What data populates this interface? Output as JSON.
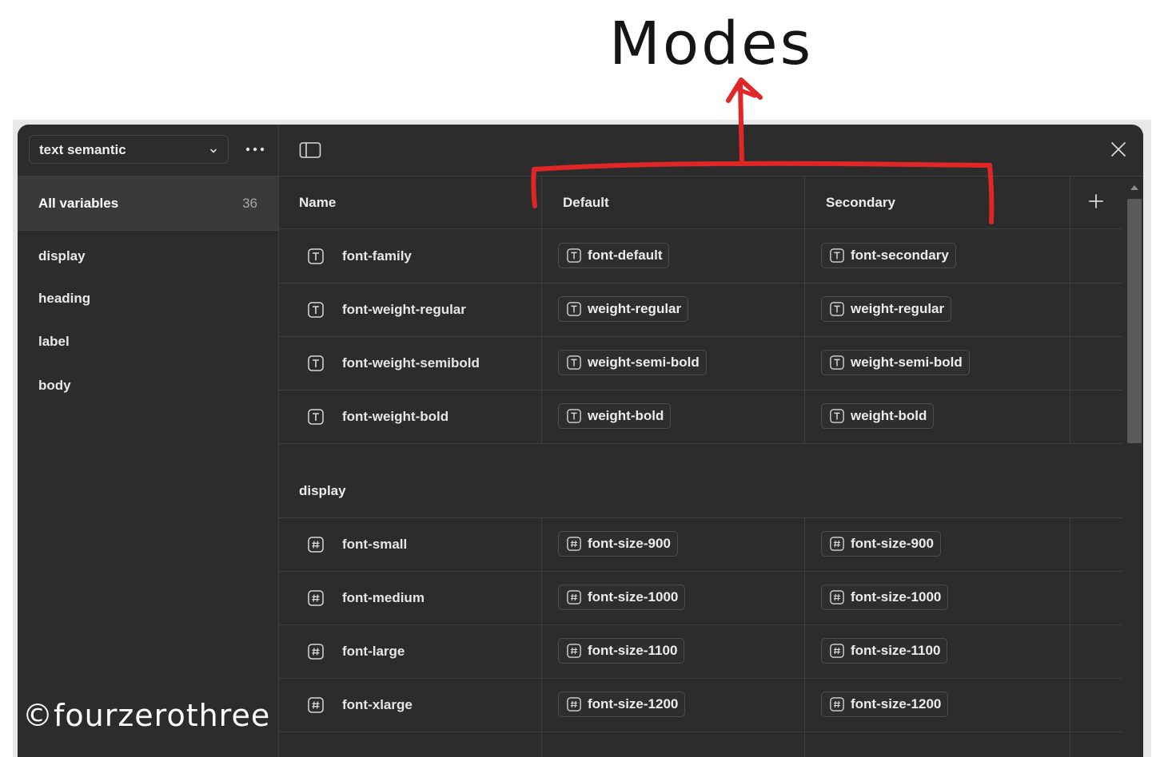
{
  "annotation": {
    "title": "Modes",
    "watermark": "©fourzerothree",
    "arrow_color": "#e02626"
  },
  "sidebar": {
    "collection": "text semantic",
    "all_variables_label": "All variables",
    "all_variables_count": "36",
    "groups": [
      {
        "label": "display"
      },
      {
        "label": "heading"
      },
      {
        "label": "label"
      },
      {
        "label": "body"
      }
    ]
  },
  "table": {
    "columns": {
      "name": "Name",
      "mode1": "Default",
      "mode2": "Secondary"
    },
    "rows": [
      {
        "type": "string",
        "name": "font-family",
        "default": "font-default",
        "secondary": "font-secondary"
      },
      {
        "type": "string",
        "name": "font-weight-regular",
        "default": "weight-regular",
        "secondary": "weight-regular"
      },
      {
        "type": "string",
        "name": "font-weight-semibold",
        "default": "weight-semi-bold",
        "secondary": "weight-semi-bold"
      },
      {
        "type": "string",
        "name": "font-weight-bold",
        "default": "weight-bold",
        "secondary": "weight-bold"
      }
    ],
    "section": {
      "label": "display",
      "rows": [
        {
          "type": "number",
          "name": "font-small",
          "default": "font-size-900",
          "secondary": "font-size-900"
        },
        {
          "type": "number",
          "name": "font-medium",
          "default": "font-size-1000",
          "secondary": "font-size-1000"
        },
        {
          "type": "number",
          "name": "font-large",
          "default": "font-size-1100",
          "secondary": "font-size-1100"
        },
        {
          "type": "number",
          "name": "font-xlarge",
          "default": "font-size-1200",
          "secondary": "font-size-1200"
        }
      ]
    }
  },
  "icons": {
    "string_type": "text-type-icon",
    "number_type": "number-type-icon",
    "chevron": "chevron-down-icon",
    "more": "more-icon",
    "panel": "panel-toggle-icon",
    "close": "close-icon",
    "add": "plus-icon"
  },
  "colors": {
    "background": "#2c2c2c",
    "selected": "#3a3a3a",
    "border": "#3f3f3f",
    "text": "#ececec"
  }
}
